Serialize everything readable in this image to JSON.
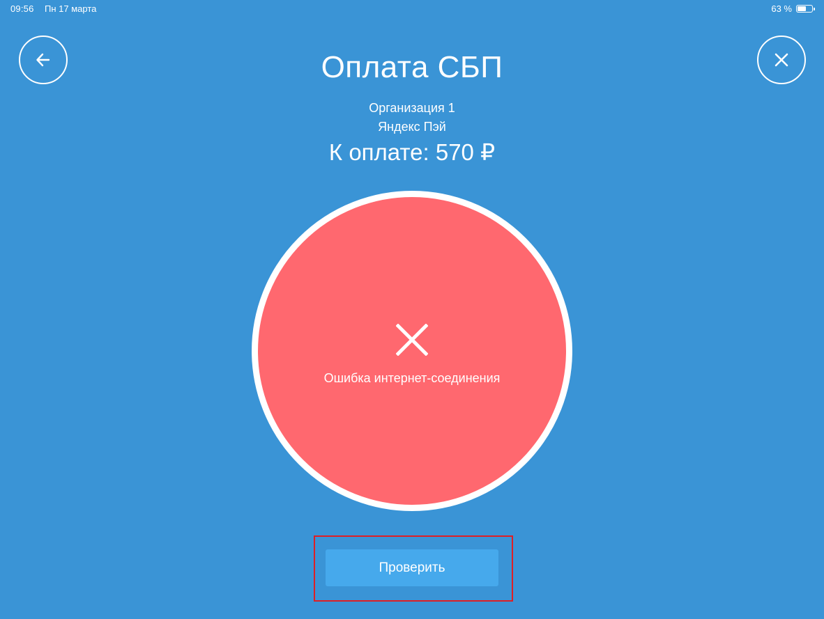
{
  "status_bar": {
    "time": "09:56",
    "date": "Пн 17 марта",
    "battery_percent": "63 %",
    "battery_level": 0.63
  },
  "header": {
    "back_icon": "arrow-left-icon",
    "close_icon": "close-icon",
    "title": "Оплата СБП"
  },
  "payment": {
    "organization": "Организация 1",
    "provider": "Яндекс Пэй",
    "amount": "К оплате: 570 ₽"
  },
  "status": {
    "icon": "error-x-icon",
    "message": "Ошибка интернет-соединения",
    "circle_color": "#ff686f"
  },
  "actions": {
    "check_label": "Проверить"
  },
  "colors": {
    "background": "#3a94d6",
    "button": "#46a9ec",
    "highlight": "#e01e24"
  }
}
